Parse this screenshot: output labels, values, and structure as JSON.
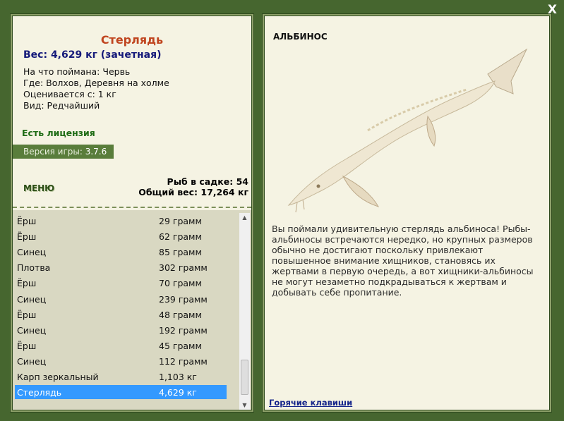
{
  "close_label": "X",
  "left": {
    "fish_name": "Стерлядь",
    "weight_line": "Вес: 4,629 кг (зачетная)",
    "caught_on": "На что поймана: Червь",
    "where": "Где: Волхов, Деревня на холме",
    "min_weight": "Оценивается с: 1 кг",
    "kind": "Вид: Редчайший",
    "license": "Есть лицензия",
    "version_label": "Версия игры: ",
    "version_value": "3.7.6",
    "menu_label": "МЕНЮ",
    "keep_count": "Рыб в садке: 54",
    "total_weight": "Общий вес: 17,264 кг"
  },
  "catch_list": [
    {
      "name": "Ёрш",
      "weight": "29 грамм"
    },
    {
      "name": "Ёрш",
      "weight": "62 грамм"
    },
    {
      "name": "Синец",
      "weight": "85 грамм"
    },
    {
      "name": "Плотва",
      "weight": "302 грамм"
    },
    {
      "name": "Ёрш",
      "weight": "70 грамм"
    },
    {
      "name": "Синец",
      "weight": "239 грамм"
    },
    {
      "name": "Ёрш",
      "weight": "48 грамм"
    },
    {
      "name": "Синец",
      "weight": "192 грамм"
    },
    {
      "name": "Ёрш",
      "weight": "45 грамм"
    },
    {
      "name": "Синец",
      "weight": "112 грамм"
    },
    {
      "name": "Карп зеркальный",
      "weight": "1,103 кг"
    },
    {
      "name": "Стерлядь",
      "weight": "4,629 кг",
      "selected": true
    }
  ],
  "right": {
    "albino_title": "АЛЬБИНОС",
    "description": "Вы поймали удивительную стерлядь альбиноса! Рыбы-альбиносы встречаются нередко, но крупных размеров обычно не достигают поскольку привлекают повышенное внимание хищников, становясь их жертвами в первую очередь, а вот хищники-альбиносы не могут незаметно подкрадываться к жертвам и добывать себе пропитание.",
    "hotkeys_link": "Горячие клавиши"
  },
  "colors": {
    "background": "#46662f",
    "panel": "#f5f3e3",
    "fish_name": "#c0451f",
    "weight_line": "#151a7a",
    "license": "#1d6b14",
    "selected_row": "#3399ff"
  }
}
